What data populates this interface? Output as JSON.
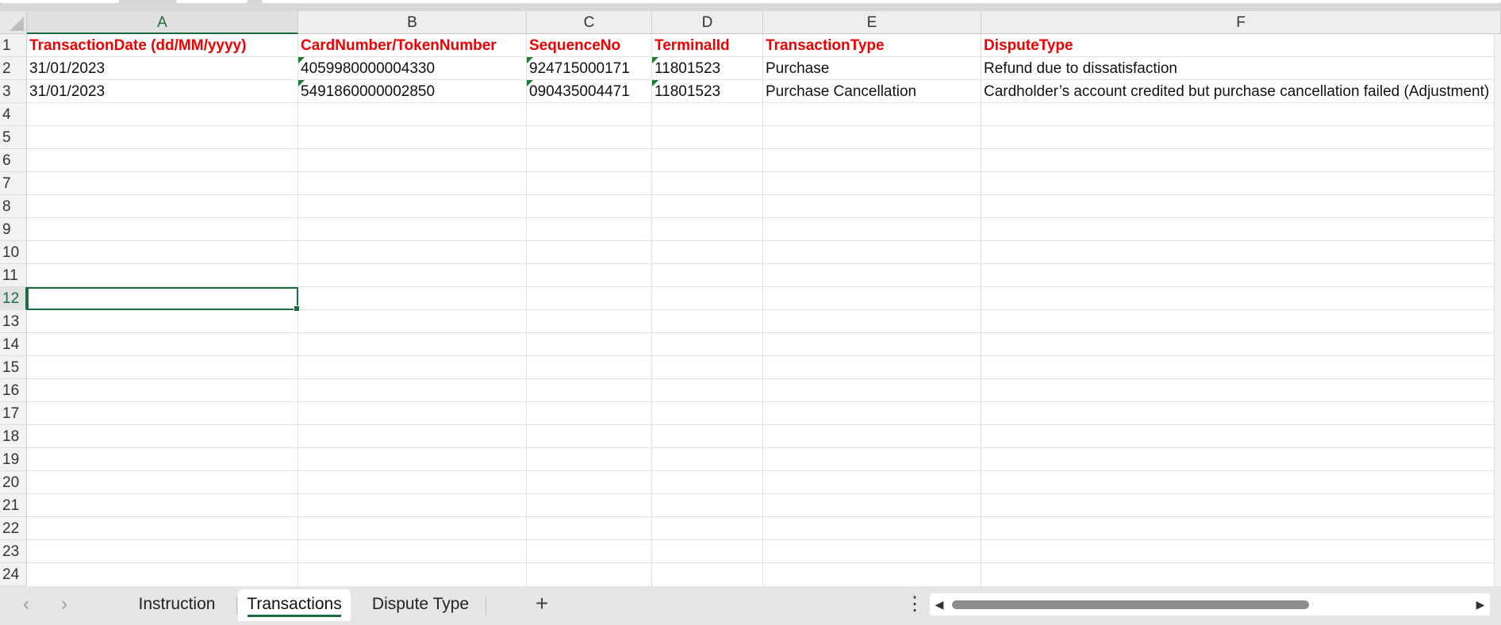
{
  "columns": [
    "A",
    "B",
    "C",
    "D",
    "E",
    "F"
  ],
  "rows": [
    "1",
    "2",
    "3",
    "4",
    "5",
    "6",
    "7",
    "8",
    "9",
    "10",
    "11",
    "12",
    "13",
    "14",
    "15",
    "16",
    "17",
    "18",
    "19",
    "20",
    "21",
    "22",
    "23",
    "24"
  ],
  "active_cell": "A12",
  "headers": {
    "A": "TransactionDate (dd/MM/yyyy)",
    "B": "CardNumber/TokenNumber",
    "C": "SequenceNo",
    "D": "TerminalId",
    "E": "TransactionType",
    "F": "DisputeType"
  },
  "data_rows": [
    {
      "A": "31/01/2023",
      "B": "4059980000004330",
      "C": "924715000171",
      "D": "11801523",
      "E": "Purchase",
      "F": "Refund due to dissatisfaction"
    },
    {
      "A": "31/01/2023",
      "B": "5491860000002850",
      "C": "090435004471",
      "D": "11801523",
      "E": "Purchase Cancellation",
      "F": "Cardholder’s account credited but purchase cancellation failed (Adjustment)"
    }
  ],
  "sheet_tabs": {
    "instruction": "Instruction",
    "transactions": "Transactions",
    "dispute_type": "Dispute Type"
  },
  "tabbar": {
    "prev_icon": "chevron-left-icon",
    "next_icon": "chevron-right-icon",
    "add_icon": "plus-icon",
    "menu_icon": "vertical-dots-icon"
  },
  "colors": {
    "header_text": "#f00000",
    "accent_green": "#1d6b3f",
    "error_triangle": "#1e7d32"
  }
}
